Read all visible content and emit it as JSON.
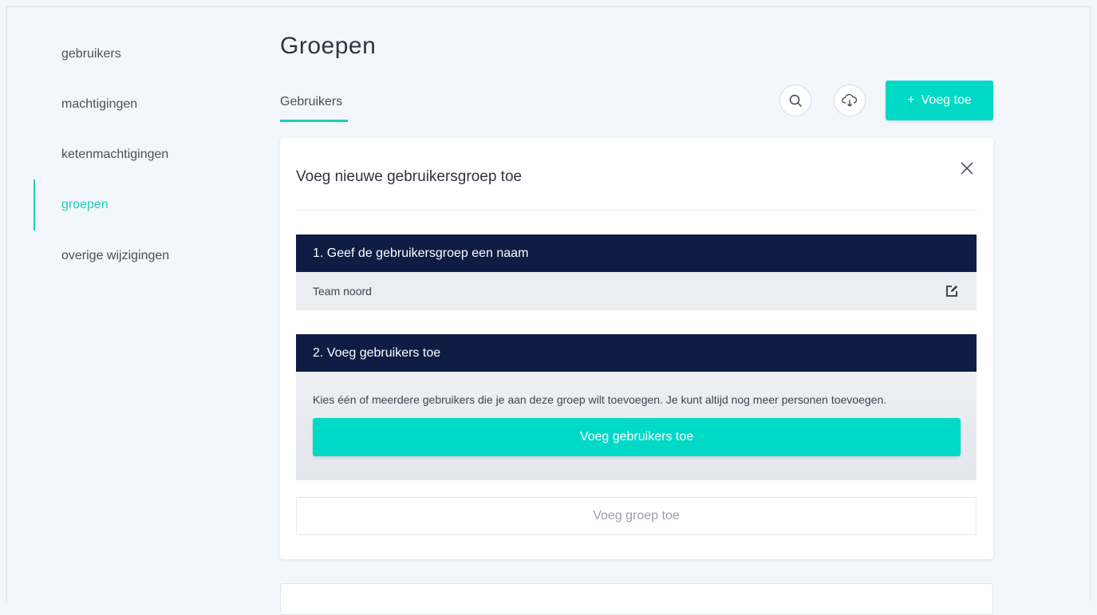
{
  "sidebar": {
    "items": [
      {
        "label": "gebruikers"
      },
      {
        "label": "machtigingen"
      },
      {
        "label": "ketenmachtigingen"
      },
      {
        "label": "groepen",
        "active": true
      },
      {
        "label": "overige wijzigingen"
      }
    ]
  },
  "header": {
    "title": "Groepen",
    "tab": "Gebruikers",
    "search_icon": "search-icon",
    "cloud_icon": "cloud-download-icon",
    "add_button": {
      "icon": "+",
      "label": "Voeg toe"
    }
  },
  "card": {
    "title": "Voeg nieuwe gebruikersgroep toe",
    "close_icon": "close-icon",
    "step1": {
      "heading": "1. Geef de gebruikersgroep een naam",
      "value": "Team noord",
      "edit_icon": "edit-icon"
    },
    "step2": {
      "heading": "2. Voeg gebruikers toe",
      "description": "Kies één of meerdere gebruikers die je aan deze groep wilt toevoegen. Je kunt altijd nog meer personen toevoegen.",
      "button": "Voeg gebruikers toe"
    },
    "submit_button": "Voeg groep toe"
  },
  "colors": {
    "accent": "#00d9c5",
    "active_text": "#1fcdbd",
    "section_header": "#0f1c44",
    "background": "#f3f6fb"
  }
}
